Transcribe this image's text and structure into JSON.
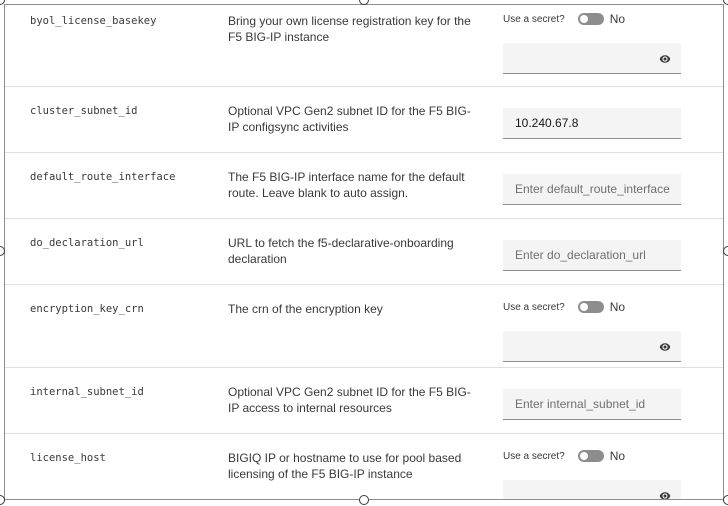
{
  "secret_label": "Use a secret?",
  "secret_state": "No",
  "rows": [
    {
      "name": "byol_license_basekey",
      "description": "Bring your own license registration key for the F5 BIG-IP instance",
      "type": "secret",
      "value": "",
      "placeholder": ""
    },
    {
      "name": "cluster_subnet_id",
      "description": "Optional VPC Gen2 subnet ID for the F5 BIG-IP configsync activities",
      "type": "input",
      "value": "10.240.67.8",
      "placeholder": ""
    },
    {
      "name": "default_route_interface",
      "description": "The F5 BIG-IP interface name for the default route. Leave blank to auto assign.",
      "type": "input",
      "value": "",
      "placeholder": "Enter default_route_interface"
    },
    {
      "name": "do_declaration_url",
      "description": "URL to fetch the f5-declarative-onboarding declaration",
      "type": "input",
      "value": "",
      "placeholder": "Enter do_declaration_url"
    },
    {
      "name": "encryption_key_crn",
      "description": "The crn of the encryption key",
      "type": "secret",
      "value": "",
      "placeholder": ""
    },
    {
      "name": "internal_subnet_id",
      "description": "Optional VPC Gen2 subnet ID for the F5 BIG-IP access to internal resources",
      "type": "input",
      "value": "",
      "placeholder": "Enter internal_subnet_id"
    },
    {
      "name": "license_host",
      "description": "BIGIQ IP or hostname to use for pool based licensing of the F5 BIG-IP instance",
      "type": "secret",
      "value": "",
      "placeholder": ""
    }
  ]
}
